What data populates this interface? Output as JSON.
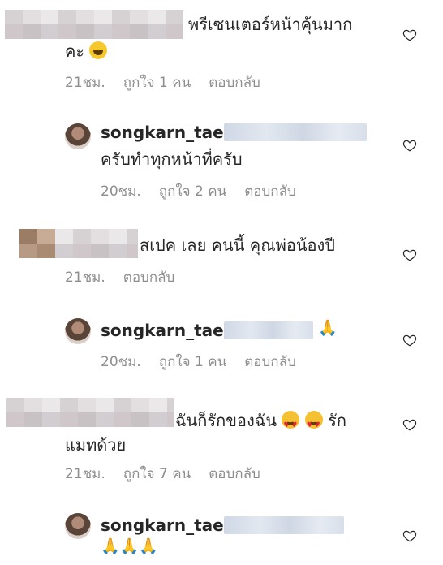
{
  "comments": [
    {
      "text_line1": "พรีเซนเตอร์หน้าคุ้นมาก",
      "text_line2": "คะ",
      "time": "21ชม.",
      "likes": "ถูกใจ 1 คน",
      "reply": "ตอบกลับ"
    },
    {
      "username": "songkarn_tae",
      "text": "ครับทำทุกหน้าที่ครับ",
      "time": "20ชม.",
      "likes": "ถูกใจ 2 คน",
      "reply": "ตอบกลับ"
    },
    {
      "text": "สเปค เลย คนนี้ คุณพ่อน้องปี",
      "time": "21ชม.",
      "reply": "ตอบกลับ"
    },
    {
      "username": "songkarn_tae",
      "time": "20ชม.",
      "likes": "ถูกใจ 1 คน",
      "reply": "ตอบกลับ"
    },
    {
      "text_line1a": "ฉันก็รักของฉัน",
      "text_line1b": "รัก",
      "text_line2": "แมทด้วย",
      "time": "21ชม.",
      "likes": "ถูกใจ 7 คน",
      "reply": "ตอบกลับ"
    },
    {
      "username": "songkarn_tae"
    }
  ],
  "icons": {
    "heart": "heart-outline-icon",
    "emoji_smile": "grinning-face-icon",
    "emoji_love": "heart-eyes-icon",
    "emoji_pray": "folded-hands-icon"
  },
  "colors": {
    "text": "#262626",
    "meta": "#8e8e8e",
    "heart_stroke": "#262626"
  }
}
